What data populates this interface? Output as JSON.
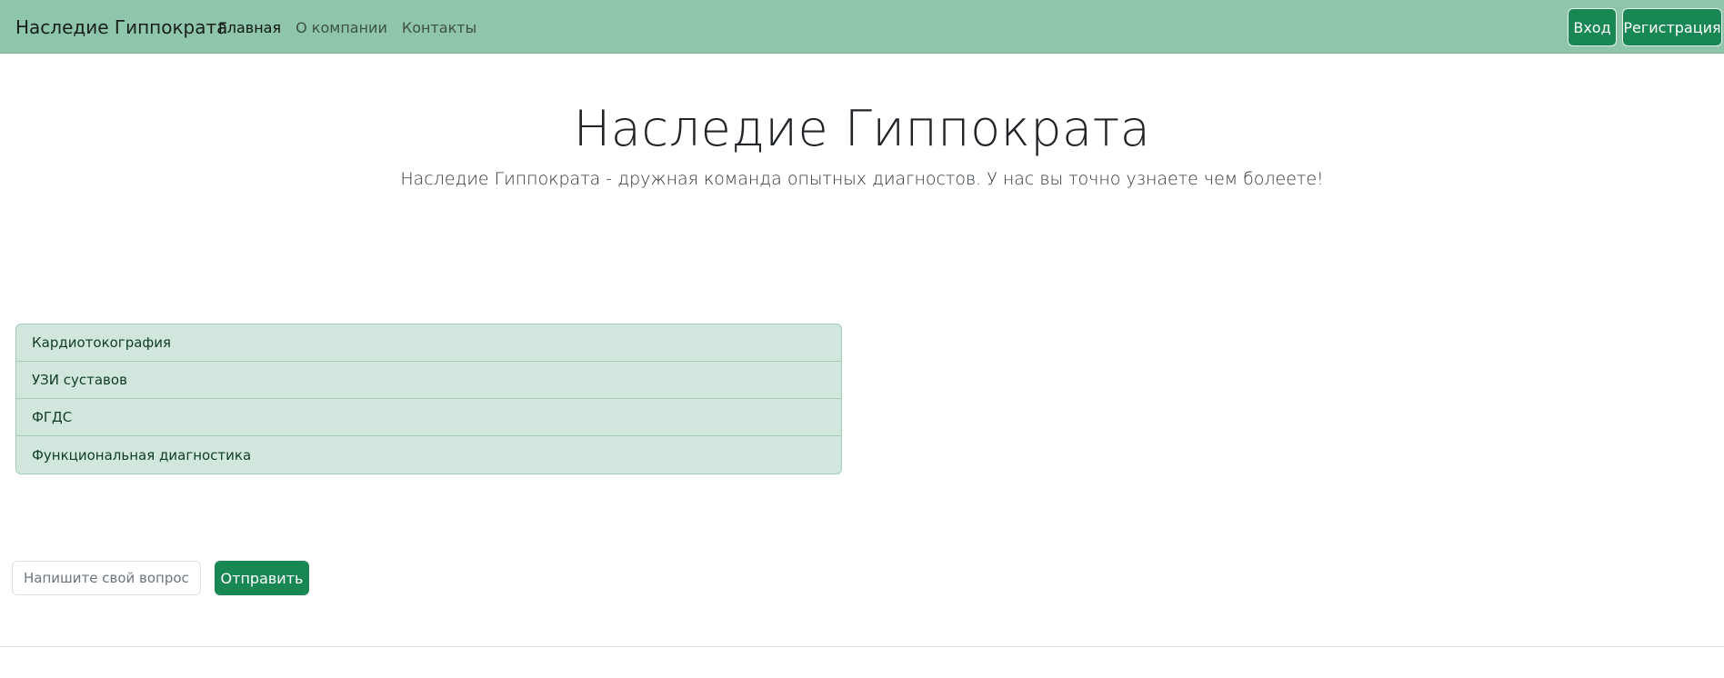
{
  "navbar": {
    "brand": "Наследие Гиппократа",
    "links": [
      {
        "label": "Главная",
        "active": true
      },
      {
        "label": "О компании",
        "active": false
      },
      {
        "label": "Контакты",
        "active": false
      }
    ],
    "login_label": "Вход",
    "register_label": "Регистрация"
  },
  "hero": {
    "title": "Наследие Гиппократа",
    "subtitle": "Наследие Гиппократа - дружная команда опытных диагностов. У нас вы точно узнаете чем болеете!"
  },
  "services": [
    {
      "label": "Кардиотокография"
    },
    {
      "label": "УЗИ суставов"
    },
    {
      "label": "ФГДС"
    },
    {
      "label": "Функциональная диагностика"
    }
  ],
  "question_form": {
    "placeholder": "Напишите свой вопрос",
    "value": "",
    "send_label": "Отправить"
  },
  "colors": {
    "navbar": "#8fc5aa",
    "primary_button": "#198754",
    "list_background": "#d1e7dd"
  }
}
